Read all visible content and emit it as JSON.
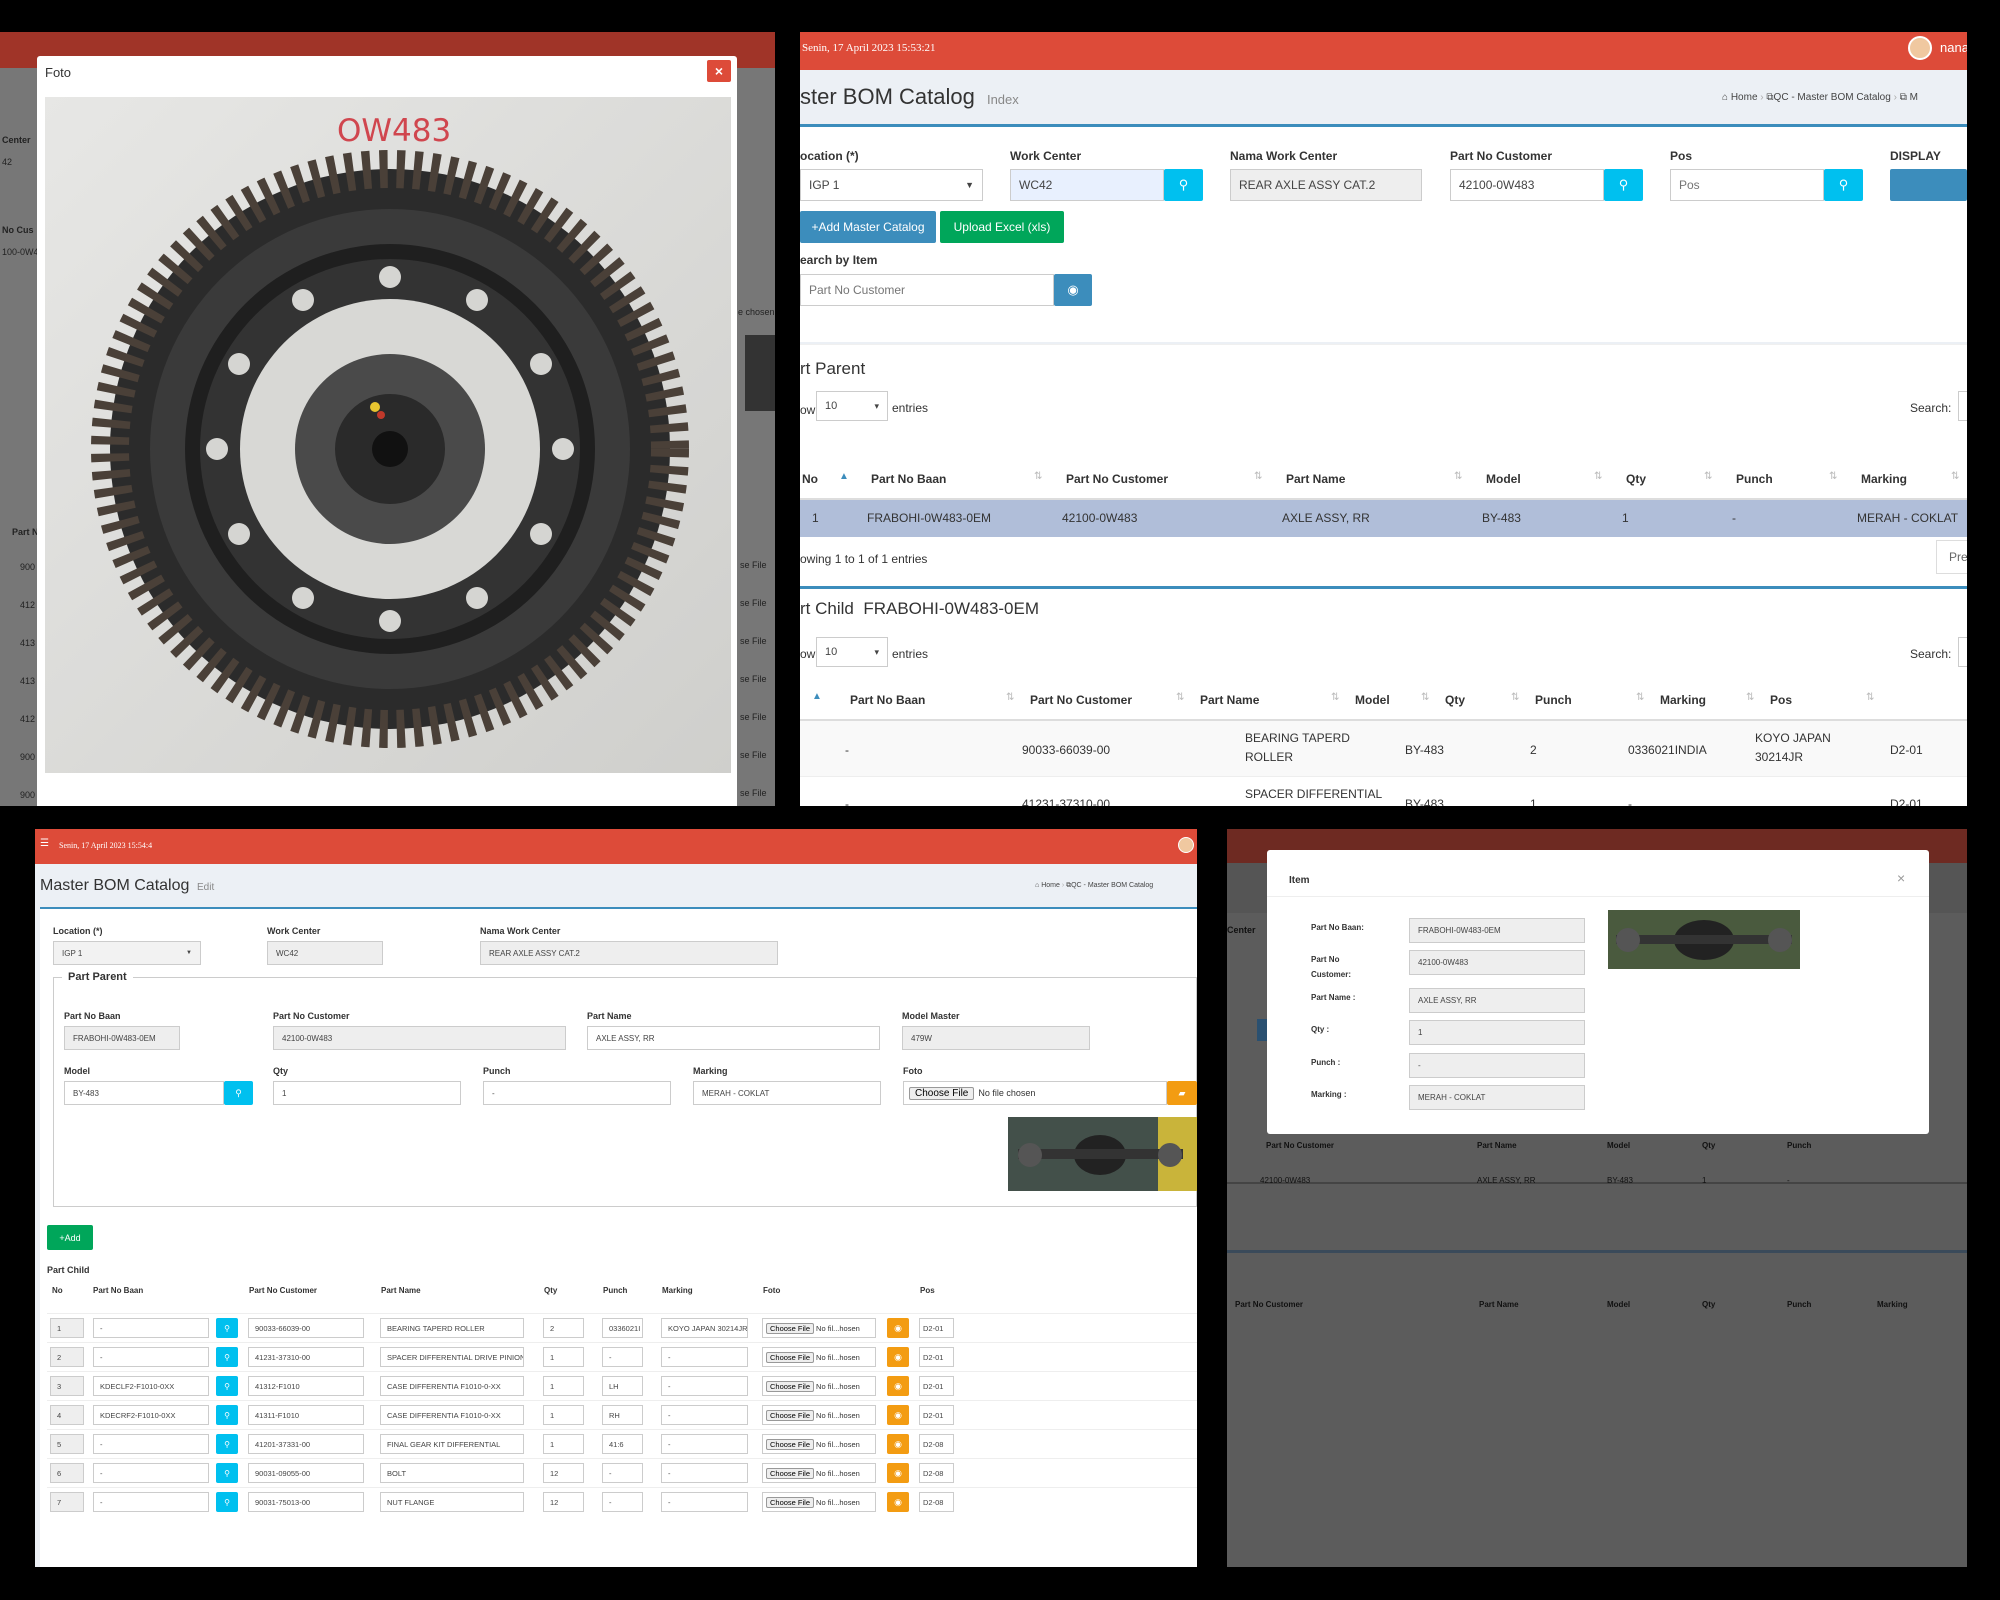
{
  "foto_modal": {
    "title": "Foto",
    "close_label": "×",
    "photo_label": "OW483"
  },
  "catalog": {
    "header_datetime": "Senin, 17 April 2023 15:53:21",
    "user_name": "nana",
    "page_title": "ster BOM Catalog",
    "page_subtitle": "Index",
    "breadcrumb": {
      "home": "Home",
      "module": "QC - Master BOM Catalog",
      "current": "M"
    },
    "fields": {
      "location": {
        "label": "ocation (*)",
        "value": "IGP 1"
      },
      "work_center": {
        "label": "Work Center",
        "value": "WC42"
      },
      "nama_wc": {
        "label": "Nama Work Center",
        "value": "REAR AXLE ASSY CAT.2"
      },
      "part_no_customer": {
        "label": "Part No Customer",
        "value": "42100-0W483"
      },
      "pos": {
        "label": "Pos",
        "placeholder": "Pos"
      },
      "display": {
        "label": "DISPLAY"
      }
    },
    "add_master_label": "Add Master Catalog",
    "upload_label": "Upload Excel (xls)",
    "search_item_label": "earch by Item",
    "search_placeholder": "Part No Customer",
    "parent": {
      "title": "rt Parent",
      "show_label": "ow",
      "entries_value": "10",
      "entries_label": "entries",
      "search_label": "Search:",
      "columns": [
        "No",
        "Part No Baan",
        "Part No Customer",
        "Part Name",
        "Model",
        "Qty",
        "Punch",
        "Marking"
      ],
      "rows": [
        [
          "1",
          "FRABOHI-0W483-0EM",
          "42100-0W483",
          "AXLE ASSY, RR",
          "BY-483",
          "1",
          "-",
          "MERAH - COKLAT"
        ]
      ],
      "info": "owing 1 to 1 of 1 entries",
      "prev_label": "Pre"
    },
    "child": {
      "title": "rt Child",
      "parent_code": "FRABOHI-0W483-0EM",
      "show_label": "ow",
      "entries_value": "10",
      "entries_label": "entries",
      "search_label": "Search:",
      "columns": [
        "Part No Baan",
        "Part No Customer",
        "Part Name",
        "Model",
        "Qty",
        "Punch",
        "Marking",
        "Pos"
      ],
      "rows": [
        {
          "baan": "-",
          "customer": "90033-66039-00",
          "name_line1": "BEARING TAPERD",
          "name_line2": "ROLLER",
          "model": "BY-483",
          "qty": "2",
          "punch": "0336021INDIA",
          "marking_line1": "KOYO JAPAN",
          "marking_line2": "30214JR",
          "pos": "D2-01"
        },
        {
          "baan": "-",
          "customer": "41231-37310-00",
          "name_line1": "SPACER DIFFERENTIAL",
          "name_line2": "DRIVE PINION BEARING",
          "model": "BY-483",
          "qty": "1",
          "punch": "-",
          "marking_line1": "-",
          "marking_line2": "",
          "pos": "D2-01"
        }
      ]
    }
  },
  "edit": {
    "header_datetime": "Senin, 17 April 2023 15:54:4",
    "page_title": "Master BOM Catalog",
    "page_subtitle": "Edit",
    "breadcrumb": {
      "home": "Home",
      "module": "QC - Master BOM Catalog"
    },
    "location": {
      "label": "Location (*)",
      "value": "IGP 1"
    },
    "work_center": {
      "label": "Work Center",
      "value": "WC42"
    },
    "nama_wc": {
      "label": "Nama Work Center",
      "value": "REAR AXLE ASSY CAT.2"
    },
    "part_parent_legend": "Part Parent",
    "parent": {
      "part_no_baan": {
        "label": "Part No Baan",
        "value": "FRABOHI-0W483-0EM"
      },
      "part_no_customer": {
        "label": "Part No Customer",
        "value": "42100-0W483"
      },
      "part_name": {
        "label": "Part Name",
        "value": "AXLE ASSY, RR"
      },
      "model_master": {
        "label": "Model Master",
        "value": "479W"
      },
      "model": {
        "label": "Model",
        "value": "BY-483"
      },
      "qty": {
        "label": "Qty",
        "value": "1"
      },
      "punch": {
        "label": "Punch",
        "value": "-"
      },
      "marking": {
        "label": "Marking",
        "value": "MERAH - COKLAT"
      },
      "foto": {
        "label": "Foto",
        "choose": "Choose File",
        "status": "No file chosen"
      }
    },
    "add_label": "Add",
    "part_child_label": "Part Child",
    "child_columns": [
      "No",
      "Part No Baan",
      "Part No Customer",
      "Part Name",
      "Qty",
      "Punch",
      "Marking",
      "Foto",
      "Pos"
    ],
    "child_choose": "Choose File",
    "child_file_status": "No fil...hosen",
    "child_rows": [
      {
        "no": "1",
        "baan": "-",
        "customer": "90033-66039-00",
        "name": "BEARING TAPERD ROLLER",
        "qty": "2",
        "punch": "0336021I",
        "marking": "KOYO JAPAN 30214JR",
        "pos": "D2-01"
      },
      {
        "no": "2",
        "baan": "-",
        "customer": "41231-37310-00",
        "name": "SPACER DIFFERENTIAL DRIVE PINION B",
        "qty": "1",
        "punch": "-",
        "marking": "-",
        "pos": "D2-01"
      },
      {
        "no": "3",
        "baan": "KDECLF2-F1010-0XX",
        "customer": "41312-F1010",
        "name": "CASE DIFFERENTIA F1010-0-XX",
        "qty": "1",
        "punch": "LH",
        "marking": "-",
        "pos": "D2-01"
      },
      {
        "no": "4",
        "baan": "KDECRF2-F1010-0XX",
        "customer": "41311-F1010",
        "name": "CASE DIFFERENTIA F1010-0-XX",
        "qty": "1",
        "punch": "RH",
        "marking": "-",
        "pos": "D2-01"
      },
      {
        "no": "5",
        "baan": "-",
        "customer": "41201-37331-00",
        "name": "FINAL GEAR KIT DIFFERENTIAL",
        "qty": "1",
        "punch": "41:6",
        "marking": "-",
        "pos": "D2-08"
      },
      {
        "no": "6",
        "baan": "-",
        "customer": "90031-09055-00",
        "name": "BOLT",
        "qty": "12",
        "punch": "-",
        "marking": "-",
        "pos": "D2-08"
      },
      {
        "no": "7",
        "baan": "-",
        "customer": "90031-75013-00",
        "name": "NUT FLANGE",
        "qty": "12",
        "punch": "-",
        "marking": "-",
        "pos": "D2-08"
      }
    ]
  },
  "item_modal": {
    "title": "Item",
    "close_label": "×",
    "fields": [
      {
        "label": "Part No Baan:",
        "value": "FRABOHI-0W483-0EM"
      },
      {
        "label": "Part No Customer:",
        "value": "42100-0W483"
      },
      {
        "label": "Part Name :",
        "value": "AXLE ASSY, RR"
      },
      {
        "label": "Qty :",
        "value": "1"
      },
      {
        "label": "Punch :",
        "value": "-"
      },
      {
        "label": "Marking :",
        "value": "MERAH - COKLAT"
      }
    ],
    "bg_header_fragment": "Center",
    "bg_table": {
      "columns": [
        "Part No Customer",
        "Part Name",
        "Model",
        "Qty",
        "Punch"
      ],
      "row": [
        "42100-0W483",
        "AXLE ASSY, RR",
        "BY-483",
        "1",
        "-"
      ]
    },
    "bg_table2": {
      "columns": [
        "Part No Customer",
        "Part Name",
        "Model",
        "Qty",
        "Punch",
        "Marking"
      ]
    }
  },
  "bg_fragments": {
    "center": "Center",
    "num2": "42",
    "no_cus": "No Cus",
    "cus_val": "100-0W4",
    "file_chosen": "e chosen",
    "part_n": "Part N",
    "choose_file": "se File",
    "rows": [
      "900",
      "412",
      "413",
      "413",
      "412",
      "900",
      "900"
    ]
  }
}
